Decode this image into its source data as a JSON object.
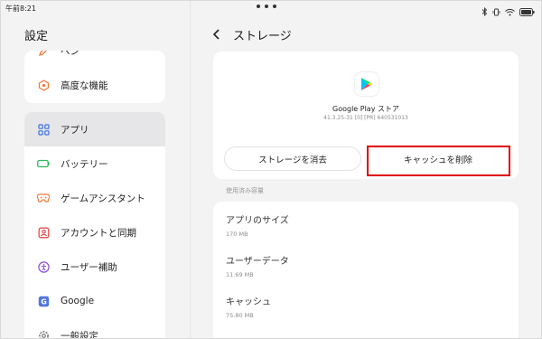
{
  "status_bar": {
    "time": "午前8:21"
  },
  "left": {
    "title": "設定",
    "top_items": [
      {
        "label": "ペン",
        "icon": "pen-icon"
      },
      {
        "label": "高度な機能",
        "icon": "advanced-features-icon"
      }
    ],
    "items": [
      {
        "label": "アプリ",
        "icon": "apps-icon",
        "selected": true
      },
      {
        "label": "バッテリー",
        "icon": "battery-icon"
      },
      {
        "label": "ゲームアシスタント",
        "icon": "game-assistant-icon"
      },
      {
        "label": "アカウントと同期",
        "icon": "account-sync-icon"
      },
      {
        "label": "ユーザー補助",
        "icon": "accessibility-icon"
      },
      {
        "label": "Google",
        "icon": "google-icon"
      },
      {
        "label": "一般設定",
        "icon": "general-settings-icon"
      }
    ]
  },
  "right": {
    "title": "ストレージ",
    "app": {
      "name": "Google Play ストア",
      "version": "41.3.25-31 [0] [PR] 640531013"
    },
    "buttons": {
      "clear_storage": "ストレージを消去",
      "clear_cache": "キャッシュを削除"
    },
    "section_label": "使用済み容量",
    "usage": [
      {
        "label": "アプリのサイズ",
        "value": "170 MB"
      },
      {
        "label": "ユーザーデータ",
        "value": "11.69 MB"
      },
      {
        "label": "キャッシュ",
        "value": "75.80 MB"
      }
    ]
  },
  "colors": {
    "highlight": "#e00000",
    "selected_bg": "#e6e6e8"
  }
}
